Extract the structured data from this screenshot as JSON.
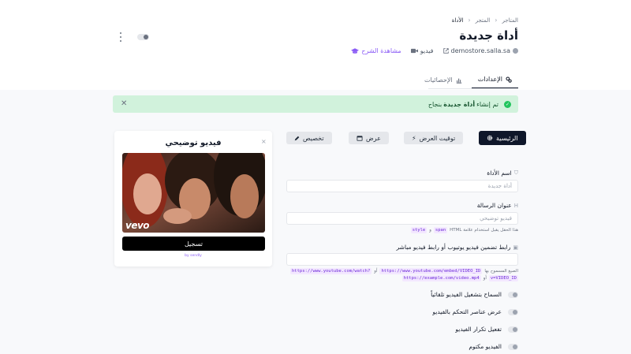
{
  "breadcrumb": {
    "items": [
      "المتاجر",
      "المتجر",
      "الأداة"
    ]
  },
  "header": {
    "title": "أداة جديدة",
    "store": "demostore.salla.sa",
    "video": "فيديو",
    "explain": "مشاهدة الشرح"
  },
  "tabs": [
    {
      "label": "الإعدادات",
      "active": true
    },
    {
      "label": "الإحصائيات",
      "active": false
    }
  ],
  "alert": {
    "prefix": "تم إنشاء",
    "bold": "أداة جديدة",
    "suffix": "بنجاح"
  },
  "actions": {
    "home": "الرئيسية",
    "timing": "توقيت العرض",
    "display": "عرض",
    "customize": "تخصيص"
  },
  "form": {
    "name_label": "اسم الأداة",
    "name_value": "أداة جديدة",
    "message_label": "عنوان الرسالة",
    "message_value": "فيديو توضيحي",
    "message_hint_text": "هذا الحقل يقبل استخدام علامة HTML",
    "message_hint_code1": "span",
    "message_hint_and": "و",
    "message_hint_code2": "style",
    "url_label": "رابط تضمين فيديو يوتيوب أو رابط فيديو مباشر",
    "url_value": "",
    "url_hint_text": "الصيغ المسموح بها",
    "url_hint_code1": "https://www.youtube.com/watch?",
    "url_hint_or1": "أو",
    "url_hint_code2": "https://www.youtube.com/embed/VIDEO_ID",
    "url_hint_code3": "v=VIDEO_ID",
    "url_hint_or2": "أو",
    "url_hint_code4": "https://example.com/video.mp4"
  },
  "switches": [
    {
      "label": "السماح بتشغيل الفيديو تلقائياً",
      "on": false
    },
    {
      "label": "عرض عناصر التحكم بالفيديو",
      "on": false
    },
    {
      "label": "تفعيل تكرار الفيديو",
      "on": false
    },
    {
      "label": "الفيديو مكتوم",
      "on": false
    }
  ],
  "preview": {
    "close": "×",
    "title": "فيديو توضيحي",
    "watermark": "vevo",
    "button": "تسجيل",
    "by": "by sendly"
  },
  "colors": {
    "primary": "#0f172a",
    "accent": "#8b5cf6",
    "success_bg": "#d1f2dc",
    "success": "#22c55e"
  }
}
